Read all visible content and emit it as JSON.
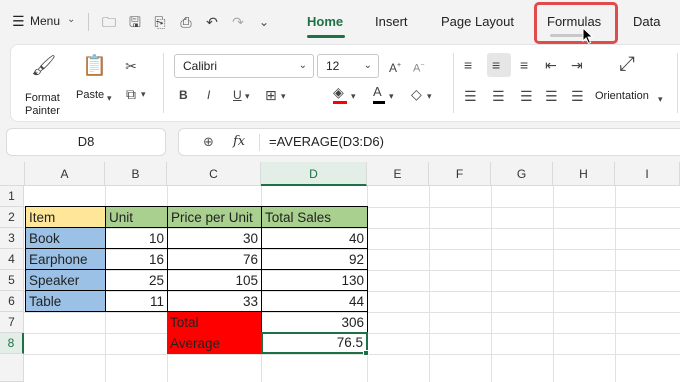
{
  "menu_label": "Menu",
  "tabs": [
    "Home",
    "Insert",
    "Page Layout",
    "Formulas",
    "Data"
  ],
  "ribbon": {
    "format_painter": "Format Painter",
    "paste": "Paste",
    "font_name": "Calibri",
    "font_size": "12",
    "orientation": "Orientation"
  },
  "name_box": "D8",
  "formula": "=AVERAGE(D3:D6)",
  "columns": [
    "A",
    "B",
    "C",
    "D",
    "E",
    "F",
    "G",
    "H",
    "I"
  ],
  "rows": [
    "1",
    "2",
    "3",
    "4",
    "5",
    "6",
    "7",
    "8"
  ],
  "table": {
    "headers": [
      "Item",
      "Unit",
      "Price per Unit",
      "Total Sales"
    ],
    "rows": [
      [
        "Book",
        "10",
        "30",
        "40"
      ],
      [
        "Earphone",
        "16",
        "76",
        "92"
      ],
      [
        "Speaker",
        "25",
        "105",
        "130"
      ],
      [
        "Table",
        "11",
        "33",
        "44"
      ]
    ],
    "total_label": "Total",
    "total_value": "306",
    "average_label": "Average",
    "average_value": "76.5"
  },
  "colors": {
    "accent": "#1e7145",
    "header_item": "#ffe699",
    "header_green": "#a9d08e",
    "item_blue": "#9bc2e6",
    "summary_red": "#ff0000",
    "highlight": "#e04b4b"
  }
}
